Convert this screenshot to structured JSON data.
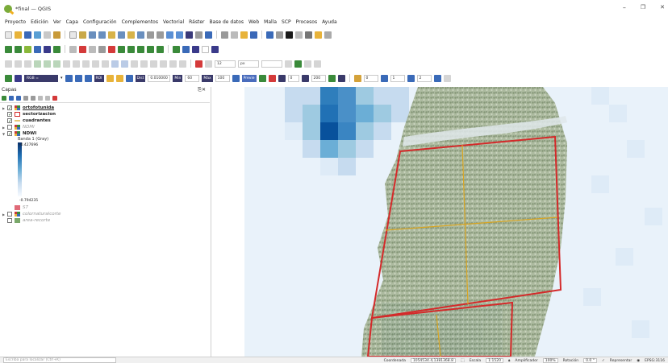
{
  "window": {
    "title": "*final — QGIS",
    "minimize": "–",
    "restore": "❐",
    "close": "✕"
  },
  "menu": [
    "Proyecto",
    "Edición",
    "Ver",
    "Capa",
    "Configuración",
    "Complementos",
    "Vectorial",
    "Ráster",
    "Base de datos",
    "Web",
    "Malla",
    "SCP",
    "Procesos",
    "Ayuda"
  ],
  "toolbar4": {
    "rgb_label": "RGB =",
    "roi_label": "ROI",
    "dist_label": "Dist",
    "dist_value": "0.010000",
    "min_label": "Min",
    "min_value": "60",
    "max_label": "Máx",
    "max_value": "100",
    "preview_label": "Previe",
    "value_0a": "0",
    "value_200": "200",
    "value_0b": "0",
    "value_1": "1",
    "value_2": "2"
  },
  "toolbar3": {
    "font_size_value": "12",
    "unit_value": "px"
  },
  "layers_panel": {
    "title": "Capas",
    "close_glyphs": "⎘✕",
    "layers": [
      {
        "name": "ortofotunida",
        "checked": true,
        "expanded": false
      },
      {
        "name": "sectorizacion",
        "checked": true
      },
      {
        "name": "cuadrantes",
        "checked": true
      },
      {
        "name": "NDMI",
        "checked": false,
        "expanded": false
      },
      {
        "name": "NDWI",
        "checked": true,
        "expanded": true
      },
      {
        "name": "S7",
        "checked": false
      },
      {
        "name": "colornaturalcorte",
        "checked": false,
        "expanded": false
      },
      {
        "name": "area-recorte",
        "checked": false
      }
    ],
    "ndwi_legend": {
      "band": "Banda 1 (Gray)",
      "max": "-0.427696",
      "min": "-0.794235"
    }
  },
  "status": {
    "locator_placeholder": "Escriba para localizar (Ctrl+K)",
    "coord_label": "Coordenada",
    "coord_value": "1054534.4,1381368.8",
    "scale_label": "Escala",
    "scale_value": "1:1520",
    "magnifier_label": "Amplificador",
    "magnifier_value": "100%",
    "rotation_label": "Rotación",
    "rotation_value": "0.0 °",
    "render_label": "Representar",
    "crs_label": "EPSG:3116"
  },
  "colors": {
    "accent_red": "#d42a2a",
    "grid_orange": "#d9a521",
    "ndwi_dark": "#08306b"
  }
}
